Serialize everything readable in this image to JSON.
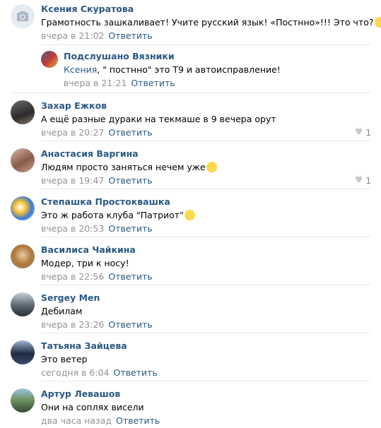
{
  "comments": [
    {
      "author": "Ксения Скуратова",
      "text": "Грамотность зашкаливает! Учите русский язык! «Постнно»!!! Это что?",
      "time": "вчера в 21:02",
      "reply_label": "Ответить",
      "emoji": "screaming-face"
    },
    {
      "author": "Подслушано Вязники",
      "reply_to": "Ксения",
      "text": ", \" постнно\" это Т9 и автоисправление!",
      "time": "вчера в 21:21",
      "reply_label": "Ответить"
    },
    {
      "author": "Захар Ежков",
      "text": "А ещё разные дураки на текмаше в 9 вечера орут",
      "time": "вчера в 20:27",
      "reply_label": "Ответить",
      "likes": "1"
    },
    {
      "author": "Анастасия Варгина",
      "text": "Людям просто заняться нечем уже",
      "time": "вчера в 19:47",
      "reply_label": "Ответить",
      "likes": "1",
      "emoji": "face-with-open-mouth"
    },
    {
      "author": "Степашка Простоквашка",
      "text": "Это ж работа клуба \"Патриот\"",
      "time": "вчера в 20:53",
      "reply_label": "Ответить",
      "emoji": "rofl-face"
    },
    {
      "author": "Василиса Чайкина",
      "text": "Модер, три к носу!",
      "time": "вчера в 22:56",
      "reply_label": "Ответить"
    },
    {
      "author": "Sergey Men",
      "text": "Дебилам",
      "time": "вчера в 23:26",
      "reply_label": "Ответить"
    },
    {
      "author": "Татьяна Зайцева",
      "text": "Это ветер",
      "time": "сегодня в 6:04",
      "reply_label": "Ответить"
    },
    {
      "author": "Артур Левашов",
      "text": "Они на соплях висели",
      "time": "два часа назад",
      "reply_label": "Ответить"
    }
  ],
  "colors": {
    "link": "#2a5885",
    "meta": "#939393",
    "separator": "#e7e8ec",
    "like": "#828282"
  }
}
